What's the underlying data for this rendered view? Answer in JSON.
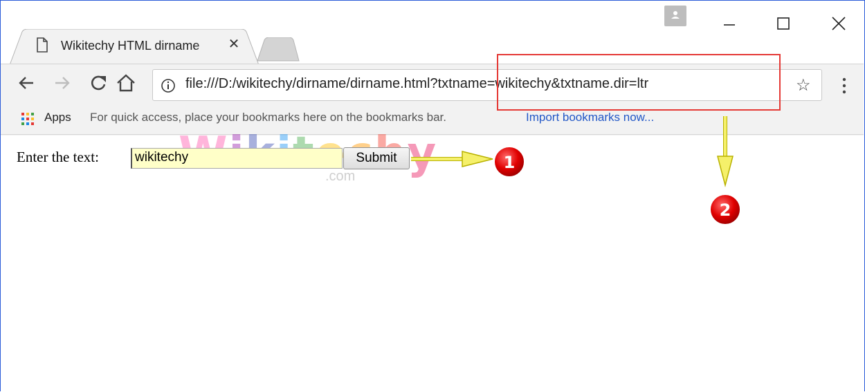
{
  "window": {
    "profile_icon": "person-icon",
    "minimize_icon": "minimize-icon",
    "maximize_icon": "maximize-icon",
    "close_icon": "close-icon"
  },
  "tab": {
    "title": "Wikitechy HTML dirname",
    "close_label": "✕"
  },
  "toolbar": {
    "url": "file:///D:/wikitechy/dirname/dirname.html?txtname=wikitechy&txtname.dir=ltr",
    "star_label": "☆"
  },
  "bookmarks": {
    "apps_label": "Apps",
    "hint": "For quick access, place your bookmarks here on the bookmarks bar.",
    "import_link": "Import bookmarks now..."
  },
  "form": {
    "label": "Enter the text:",
    "input_value": "wikitechy",
    "submit_label": "Submit"
  },
  "watermark": {
    "text": "Wikitechy",
    "suffix": ".com"
  },
  "annotations": {
    "badge1": "1",
    "badge2": "2",
    "highlight_color": "#e53935",
    "arrow_color": "#f5f06a",
    "badge_color": "#e00000"
  }
}
